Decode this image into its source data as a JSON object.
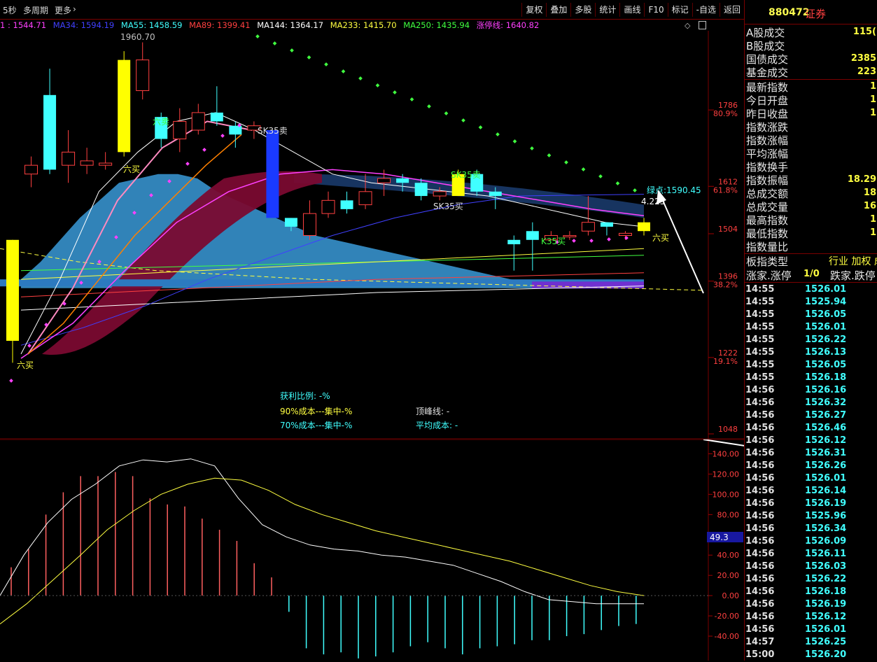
{
  "topbar": {
    "period": "5秒",
    "multi_period": "多周期",
    "more": "更多",
    "tools": [
      "复权",
      "叠加",
      "多股",
      "统计",
      "画线",
      "F10",
      "标记",
      "-自选",
      "返回"
    ]
  },
  "ma_line": [
    {
      "text": "1 : 1544.71",
      "color": "#ff40ff"
    },
    {
      "text": "MA34: 1594.19",
      "color": "#4040ff"
    },
    {
      "text": "MA55: 1458.59",
      "color": "#40ffff"
    },
    {
      "text": "MA89: 1399.41",
      "color": "#ff4040"
    },
    {
      "text": "MA144: 1364.17",
      "color": "#ffffff"
    },
    {
      "text": "MA233: 1415.70",
      "color": "#ffff40"
    },
    {
      "text": "MA250: 1435.94",
      "color": "#40ff40"
    },
    {
      "text": "涨停线: 1640.82",
      "color": "#ff40ff"
    }
  ],
  "main_chart": {
    "ylim": [
      1048,
      1960
    ],
    "y_ticks": [
      {
        "v": 1786,
        "label": "1786",
        "pct": "80.9%"
      },
      {
        "v": 1612,
        "label": "1612",
        "pct": "61.8%"
      },
      {
        "v": 1504,
        "label": "1504",
        "pct": ""
      },
      {
        "v": 1396,
        "label": "1396",
        "pct": "38.2%"
      },
      {
        "v": 1222,
        "label": "1222",
        "pct": "19.1%"
      },
      {
        "v": 1048,
        "label": "1048",
        "pct": ""
      }
    ],
    "high_label": "1960.70",
    "green_point": "绿点:1590.45",
    "green_val": "4.225",
    "annotations": [
      "六卖",
      "六买",
      "SK35卖",
      "SK35卖",
      "SK35买",
      "六买",
      "K35买",
      "六买"
    ],
    "stats": {
      "profit_ratio": "获利比例: -%",
      "cost90": "90%成本---集中-%",
      "cost70": "70%成本---集中-%",
      "peak": "顶峰线: -",
      "avg_cost": "平均成本: -"
    }
  },
  "chart_data": [
    {
      "type": "candlestick",
      "title": "",
      "ylim": [
        1048,
        1960
      ],
      "candles": [
        {
          "o": 1260,
          "c": 1490,
          "h": 1490,
          "l": 1210,
          "color": "yellow"
        },
        {
          "o": 1660,
          "c": 1640,
          "h": 1680,
          "l": 1610,
          "color": "red"
        },
        {
          "o": 1650,
          "c": 1820,
          "h": 1880,
          "l": 1640,
          "color": "cyan"
        },
        {
          "o": 1660,
          "c": 1690,
          "h": 1740,
          "l": 1620,
          "color": "red"
        },
        {
          "o": 1660,
          "c": 1670,
          "h": 1700,
          "l": 1640,
          "color": "red"
        },
        {
          "o": 1660,
          "c": 1665,
          "h": 1690,
          "l": 1650,
          "color": "red"
        },
        {
          "o": 1690,
          "c": 1900,
          "h": 1920,
          "l": 1680,
          "color": "yellow"
        },
        {
          "o": 1830,
          "c": 1900,
          "h": 1940,
          "l": 1810,
          "color": "red"
        },
        {
          "o": 1770,
          "c": 1720,
          "h": 1780,
          "l": 1700,
          "color": "cyan"
        },
        {
          "o": 1720,
          "c": 1760,
          "h": 1790,
          "l": 1690,
          "color": "red"
        },
        {
          "o": 1740,
          "c": 1780,
          "h": 1800,
          "l": 1730,
          "color": "red"
        },
        {
          "o": 1780,
          "c": 1760,
          "h": 1840,
          "l": 1750,
          "color": "cyan"
        },
        {
          "o": 1750,
          "c": 1730,
          "h": 1760,
          "l": 1700,
          "color": "cyan"
        },
        {
          "o": 1740,
          "c": 1750,
          "h": 1760,
          "l": 1720,
          "color": "red"
        },
        {
          "o": 1740,
          "c": 1540,
          "h": 1740,
          "l": 1540,
          "color": "blue"
        },
        {
          "o": 1540,
          "c": 1520,
          "h": 1540,
          "l": 1510,
          "color": "cyan"
        },
        {
          "o": 1500,
          "c": 1550,
          "h": 1580,
          "l": 1490,
          "color": "red"
        },
        {
          "o": 1550,
          "c": 1580,
          "h": 1600,
          "l": 1540,
          "color": "red"
        },
        {
          "o": 1580,
          "c": 1560,
          "h": 1600,
          "l": 1550,
          "color": "cyan"
        },
        {
          "o": 1570,
          "c": 1600,
          "h": 1640,
          "l": 1560,
          "color": "red"
        },
        {
          "o": 1620,
          "c": 1630,
          "h": 1650,
          "l": 1590,
          "color": "red"
        },
        {
          "o": 1630,
          "c": 1620,
          "h": 1640,
          "l": 1600,
          "color": "cyan"
        },
        {
          "o": 1620,
          "c": 1590,
          "h": 1630,
          "l": 1580,
          "color": "cyan"
        },
        {
          "o": 1590,
          "c": 1600,
          "h": 1610,
          "l": 1580,
          "color": "red"
        },
        {
          "o": 1590,
          "c": 1640,
          "h": 1650,
          "l": 1590,
          "color": "yellow"
        },
        {
          "o": 1640,
          "c": 1600,
          "h": 1650,
          "l": 1590,
          "color": "cyan"
        },
        {
          "o": 1600,
          "c": 1590,
          "h": 1610,
          "l": 1560,
          "color": "cyan"
        },
        {
          "o": 1480,
          "c": 1490,
          "h": 1500,
          "l": 1420,
          "color": "cyan"
        },
        {
          "o": 1490,
          "c": 1510,
          "h": 1530,
          "l": 1420,
          "color": "cyan"
        },
        {
          "o": 1490,
          "c": 1500,
          "h": 1510,
          "l": 1490,
          "color": "red"
        },
        {
          "o": 1500,
          "c": 1500,
          "h": 1510,
          "l": 1490,
          "color": "red"
        },
        {
          "o": 1510,
          "c": 1530,
          "h": 1590,
          "l": 1500,
          "color": "red"
        },
        {
          "o": 1530,
          "c": 1520,
          "h": 1530,
          "l": 1500,
          "color": "cyan"
        },
        {
          "o": 1500,
          "c": 1505,
          "h": 1510,
          "l": 1490,
          "color": "red"
        },
        {
          "o": 1510,
          "c": 1530,
          "h": 1540,
          "l": 1500,
          "color": "yellow"
        }
      ]
    },
    {
      "type": "bar",
      "title": "",
      "ylim": [
        -60,
        150
      ],
      "y_ticks": [
        140,
        120,
        100,
        80,
        60,
        40,
        20,
        0,
        -20,
        -40
      ],
      "current_label": "49.3",
      "values": [
        28,
        46,
        80,
        102,
        118,
        118,
        122,
        118,
        96,
        90,
        88,
        76,
        65,
        54,
        32,
        18,
        -16,
        -52,
        -58,
        -56,
        -62,
        -60,
        -56,
        -50,
        -46,
        -52,
        -58,
        -52,
        -50,
        -48,
        -44,
        -44,
        -40,
        -38,
        -34,
        -30,
        -28
      ],
      "series": [
        {
          "name": "",
          "color": "#ffffff",
          "values": [
            0,
            40,
            72,
            95,
            110,
            128,
            134,
            132,
            135,
            128,
            96,
            70,
            58,
            50,
            46,
            44,
            40,
            38,
            34,
            30,
            22,
            14,
            4,
            -4,
            -6,
            -8,
            -8,
            -8
          ]
        },
        {
          "name": "",
          "color": "#ffff40",
          "values": [
            -28,
            -8,
            16,
            40,
            65,
            84,
            100,
            110,
            116,
            114,
            104,
            90,
            80,
            72,
            64,
            58,
            52,
            46,
            40,
            34,
            26,
            18,
            10,
            4,
            0
          ]
        }
      ]
    }
  ],
  "right_panel": {
    "code": "880472",
    "name": "证券",
    "rows_a": [
      {
        "label": "A股成交",
        "value": "115("
      },
      {
        "label": "B股成交",
        "value": ""
      },
      {
        "label": "国债成交",
        "value": "2385"
      },
      {
        "label": "基金成交",
        "value": "223"
      }
    ],
    "rows_b": [
      {
        "label": "最新指数",
        "value": "1"
      },
      {
        "label": "今日开盘",
        "value": "1"
      },
      {
        "label": "昨日收盘",
        "value": "1"
      },
      {
        "label": "指数涨跌",
        "value": ""
      },
      {
        "label": "指数涨幅",
        "value": ""
      },
      {
        "label": "平均涨幅",
        "value": ""
      },
      {
        "label": "指数换手",
        "value": ""
      },
      {
        "label": "指数振幅",
        "value": "18.29"
      },
      {
        "label": "总成交额",
        "value": "18"
      },
      {
        "label": "总成交量",
        "value": "16"
      },
      {
        "label": "最高指数",
        "value": "1"
      },
      {
        "label": "最低指数",
        "value": "1"
      },
      {
        "label": "指数量比",
        "value": ""
      }
    ],
    "plate_type": "板指类型",
    "plate_val": "行业 加权 成",
    "up_down": "涨家.涨停",
    "ratio": "1/0",
    "down_label": "跌家.跌停",
    "ticks": [
      {
        "t": "14:55",
        "p": "1526.01"
      },
      {
        "t": "14:55",
        "p": "1525.94"
      },
      {
        "t": "14:55",
        "p": "1526.05"
      },
      {
        "t": "14:55",
        "p": "1526.01"
      },
      {
        "t": "14:55",
        "p": "1526.22"
      },
      {
        "t": "14:55",
        "p": "1526.13"
      },
      {
        "t": "14:55",
        "p": "1526.05"
      },
      {
        "t": "14:55",
        "p": "1526.18"
      },
      {
        "t": "14:56",
        "p": "1526.16"
      },
      {
        "t": "14:56",
        "p": "1526.32"
      },
      {
        "t": "14:56",
        "p": "1526.27"
      },
      {
        "t": "14:56",
        "p": "1526.46"
      },
      {
        "t": "14:56",
        "p": "1526.12"
      },
      {
        "t": "14:56",
        "p": "1526.31"
      },
      {
        "t": "14:56",
        "p": "1526.26"
      },
      {
        "t": "14:56",
        "p": "1526.01"
      },
      {
        "t": "14:56",
        "p": "1526.14"
      },
      {
        "t": "14:56",
        "p": "1526.19"
      },
      {
        "t": "14:56",
        "p": "1525.96"
      },
      {
        "t": "14:56",
        "p": "1526.34"
      },
      {
        "t": "14:56",
        "p": "1526.09"
      },
      {
        "t": "14:56",
        "p": "1526.11"
      },
      {
        "t": "14:56",
        "p": "1526.03"
      },
      {
        "t": "14:56",
        "p": "1526.22"
      },
      {
        "t": "14:56",
        "p": "1526.18"
      },
      {
        "t": "14:56",
        "p": "1526.19"
      },
      {
        "t": "14:56",
        "p": "1526.12"
      },
      {
        "t": "14:56",
        "p": "1526.01"
      },
      {
        "t": "14:57",
        "p": "1526.25"
      },
      {
        "t": "15:00",
        "p": "1526.20"
      }
    ]
  }
}
